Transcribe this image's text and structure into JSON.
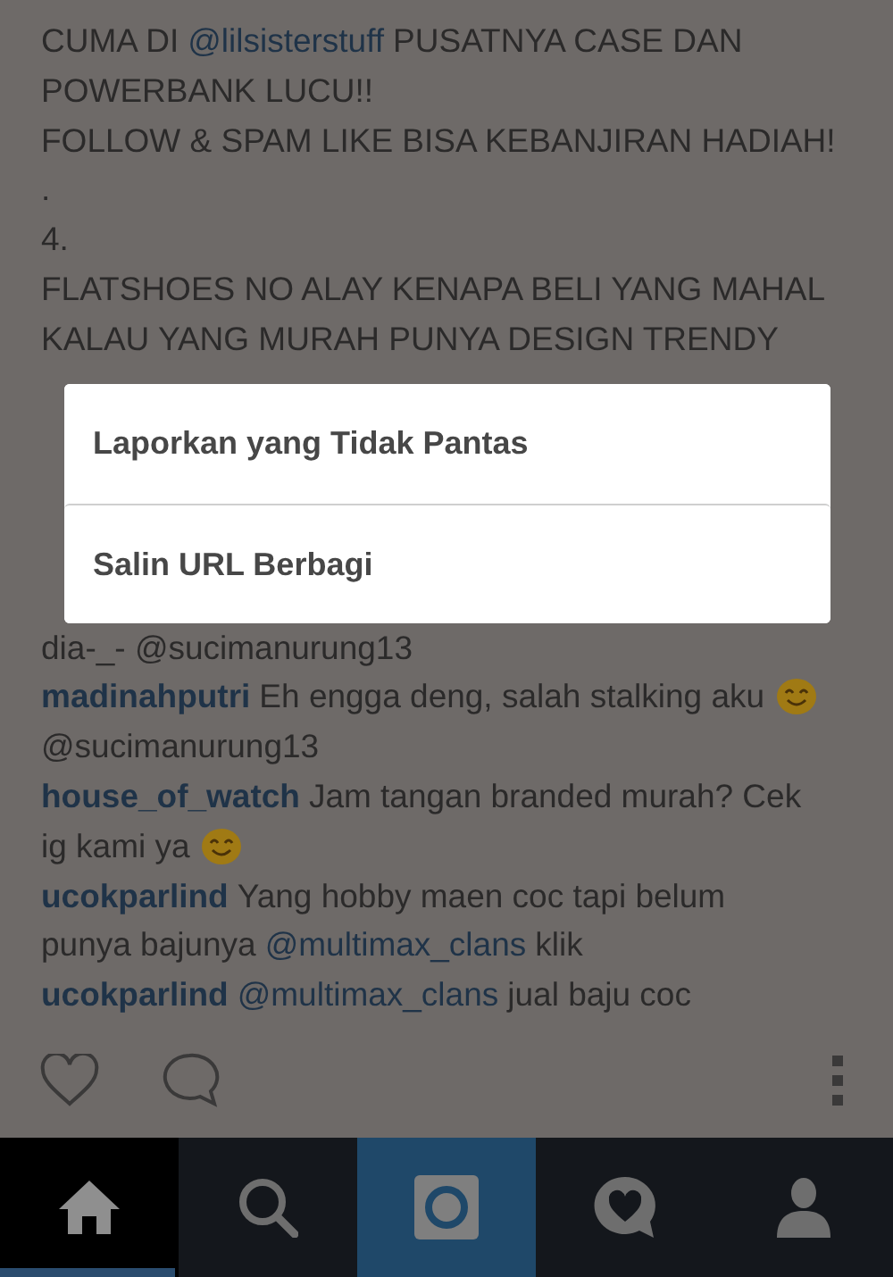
{
  "post_lines": [
    [
      {
        "kind": "text",
        "text": "CUMA DI"
      },
      {
        "kind": "mention",
        "text": "@lilsisterstuff"
      },
      {
        "kind": "text",
        "text": "PUSATNYA CASE DAN"
      }
    ],
    [
      {
        "kind": "text",
        "text": "POWERBANK LUCU!!"
      }
    ],
    [
      {
        "kind": "text",
        "text": "FOLLOW & SPAM LIKE BISA KEBANJIRAN HADIAH!"
      }
    ],
    [
      {
        "kind": "text",
        "text": "."
      }
    ],
    [
      {
        "kind": "text",
        "text": "4."
      }
    ],
    [
      {
        "kind": "text",
        "text": "FLATSHOES NO ALAY KENAPA BELI YANG MAHAL"
      }
    ],
    [
      {
        "kind": "text",
        "text": "KALAU YANG MURAH PUNYA DESIGN TRENDY"
      }
    ],
    [
      {
        "kind": "text",
        "text": "dia-_- @sucimanurung13"
      }
    ],
    [
      {
        "kind": "username",
        "text": "madinahputri"
      },
      {
        "kind": "text",
        "text": "Eh engga deng, salah stalking aku"
      },
      {
        "kind": "emoji"
      }
    ],
    [
      {
        "kind": "text",
        "text": "@sucimanurung13"
      }
    ],
    [
      {
        "kind": "username",
        "text": "house_of_watch"
      },
      {
        "kind": "text",
        "text": "Jam tangan branded murah? Cek"
      }
    ],
    [
      {
        "kind": "text",
        "text": "ig kami ya"
      },
      {
        "kind": "emoji"
      }
    ],
    [
      {
        "kind": "username",
        "text": "ucokparlind"
      },
      {
        "kind": "text",
        "text": "Yang hobby maen coc tapi belum"
      }
    ],
    [
      {
        "kind": "text",
        "text": "punya bajunya"
      },
      {
        "kind": "mention",
        "text": "@multimax_clans"
      },
      {
        "kind": "text",
        "text": "klik"
      }
    ],
    [
      {
        "kind": "username",
        "text": "ucokparlind"
      },
      {
        "kind": "mention",
        "text": "@multimax_clans"
      },
      {
        "kind": "text",
        "text": "jual baju coc"
      }
    ]
  ],
  "dialog": {
    "items": [
      "Laporkan yang Tidak Pantas",
      "Salin URL Berbagi"
    ]
  },
  "nav": [
    {
      "kind": "home",
      "selected": true
    },
    {
      "kind": "search",
      "selected": false
    },
    {
      "kind": "camera",
      "selected": false
    },
    {
      "kind": "activity",
      "selected": false
    },
    {
      "kind": "profile",
      "selected": false
    }
  ]
}
